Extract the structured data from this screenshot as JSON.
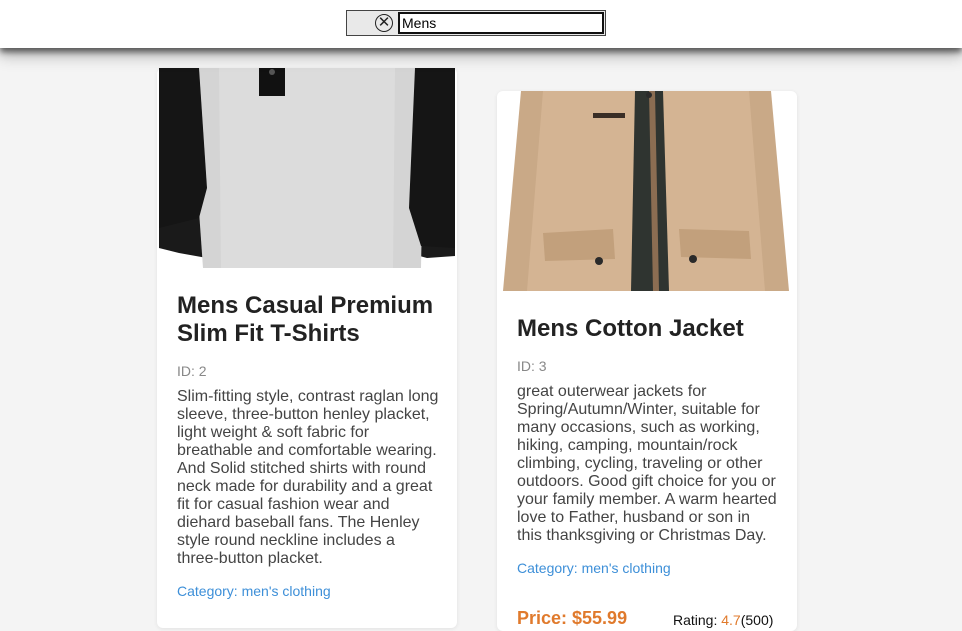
{
  "search": {
    "value": "Mens",
    "clear_symbol": "✕"
  },
  "products": [
    {
      "title": "Mens Casual Premium Slim Fit T-Shirts",
      "id_label": "ID: 2",
      "description": "Slim-fitting style, contrast raglan long sleeve, three-button henley placket, light weight & soft fabric for breathable and comfortable wearing. And Solid stitched shirts with round neck made for durability and a great fit for casual fashion wear and diehard baseball fans. The Henley style round neckline includes a three-button placket.",
      "category_label": "Category: men's clothing"
    },
    {
      "title": "Mens Cotton Jacket",
      "id_label": "ID: 3",
      "description": "great outerwear jackets for Spring/Autumn/Winter, suitable for many occasions, such as working, hiking, camping, mountain/rock climbing, cycling, traveling or other outdoors. Good gift choice for you or your family member. A warm hearted love to Father, husband or son in this thanksgiving or Christmas Day.",
      "category_label": "Category: men's clothing",
      "price_label": "Price: $55.99",
      "rating_prefix": "Rating: ",
      "rating_value": "4.7",
      "rating_count": "(500)"
    }
  ],
  "colors": {
    "accent_orange": "#e07a2c",
    "link_blue": "#3d8fd8",
    "background": "#f4f4f4"
  }
}
